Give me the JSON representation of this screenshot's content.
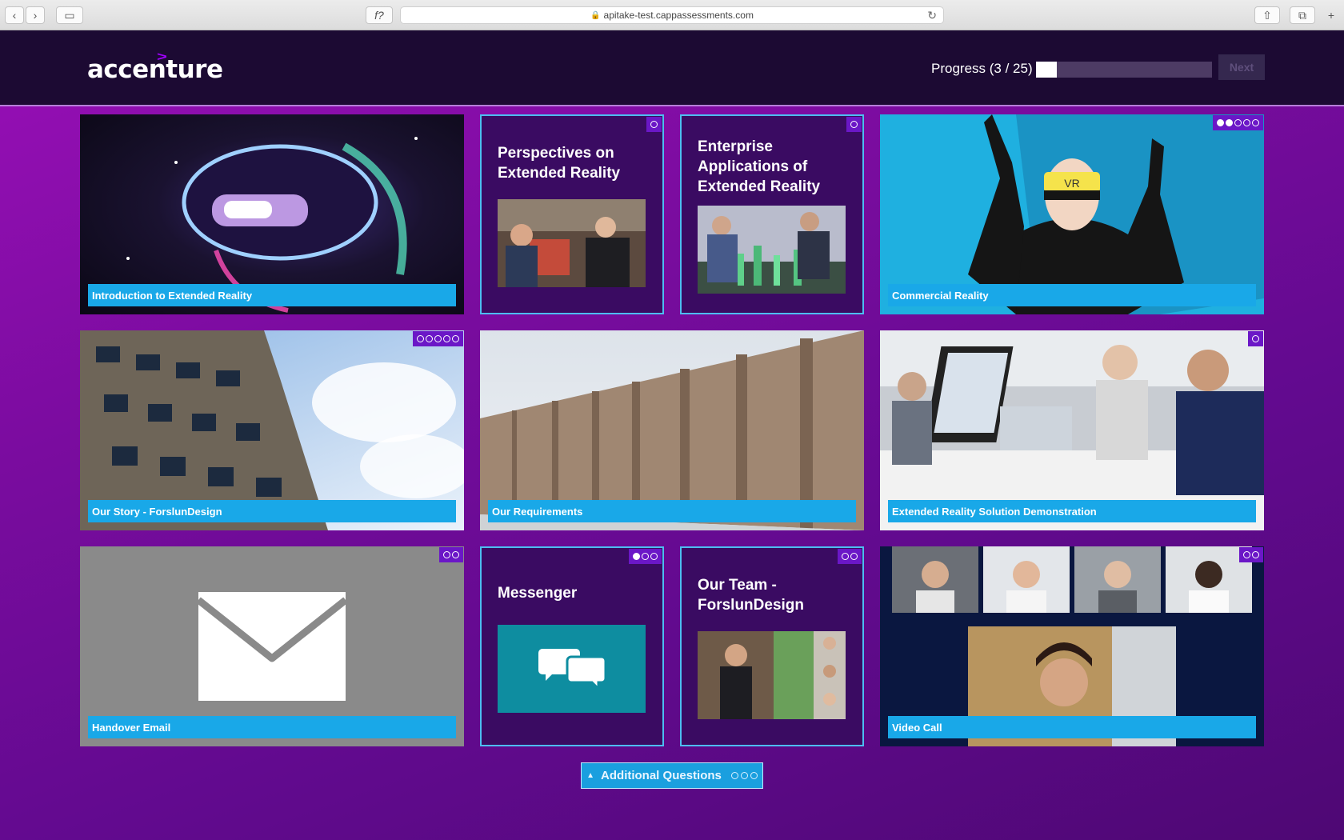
{
  "browser": {
    "url": "apitake-test.cappassessments.com",
    "back_icon": "‹",
    "forward_icon": "›",
    "sidebar_icon": "▭",
    "reader_icon": "f?",
    "share_icon": "⇧",
    "tabs_icon": "⧉",
    "newtab_icon": "+"
  },
  "header": {
    "logo_text": "accenture",
    "logo_mark": ">",
    "progress_label": "Progress (3 / 25)",
    "progress_fraction": 0.12,
    "next_label": "Next"
  },
  "tiles": [
    {
      "label": "Introduction to Extended Reality",
      "dots": []
    },
    {
      "title": "Perspectives on Extended Reality",
      "dots": [
        0
      ]
    },
    {
      "title": "Enterprise Applications of Extended Reality",
      "dots": [
        0
      ]
    },
    {
      "label": "Commercial Reality",
      "dots": [
        1,
        1,
        0,
        0,
        0
      ],
      "image_text": "VR"
    },
    {
      "label": "Our Story - ForslunDesign",
      "dots": [
        0,
        0,
        0,
        0,
        0
      ]
    },
    {
      "label": "Our Requirements",
      "dots": []
    },
    {
      "label": "Extended Reality Solution Demonstration",
      "dots": [
        0
      ]
    },
    {
      "label": "Handover Email",
      "dots": [
        0,
        0
      ]
    },
    {
      "title": "Messenger",
      "dots": [
        1,
        0,
        0
      ]
    },
    {
      "title": "Our Team - ForslunDesign",
      "dots": [
        0,
        0
      ]
    },
    {
      "label": "Video Call",
      "dots": [
        0,
        0
      ]
    }
  ],
  "additional_questions": {
    "label": "Additional Questions",
    "dots": [
      0,
      0,
      0
    ]
  },
  "colors": {
    "accent": "#a100ff",
    "tile_label": "#19a8e8",
    "card_bg": "#3a0b62"
  }
}
